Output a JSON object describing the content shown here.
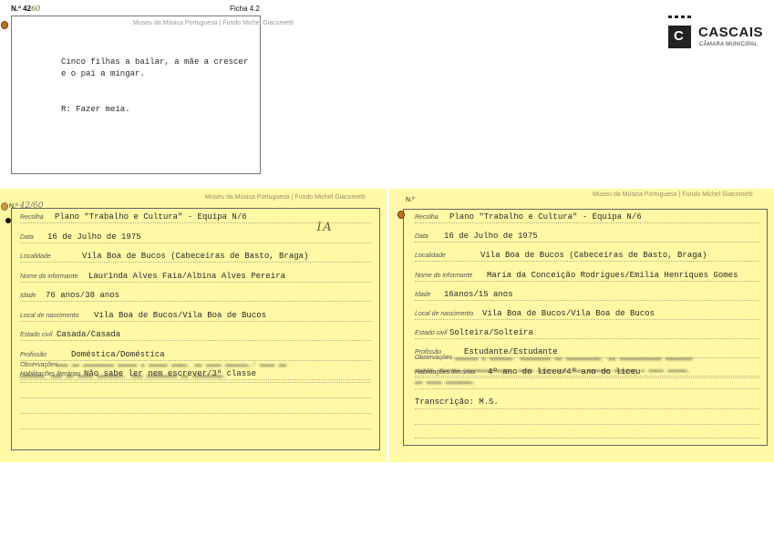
{
  "logo": {
    "name": "CASCAIS",
    "subtitle": "CÂMARA MUNICIPAL",
    "letter": "C"
  },
  "top_card": {
    "number_label": "N.º",
    "number_value": "42",
    "number_handwritten": "60",
    "ficha": "Ficha 4.2",
    "header": "Museu da Música Portuguesa | Fundo Michel Giacometti",
    "line1": "Cinco filhas a bailar, a mãe a crescer",
    "line2": "e o pai a mingar.",
    "answer": "R: Fazer meia."
  },
  "left_card": {
    "number_label": "N.º",
    "number_handwritten": "42/60",
    "header": "Museu da Música Portuguesa | Fundo Michel Giacometti",
    "handwritten_mark": "1A",
    "fields": [
      {
        "label": "Recolha",
        "value": "Plano \"Trabalho e Cultura\" - Equipa N/6"
      },
      {
        "label": "Data",
        "value": "16 de Julho de 1975"
      },
      {
        "label": "Localidade",
        "value": "Vila Boa de Bucos (Cabeceiras de Basto, Braga)"
      },
      {
        "label": "Nome do informante",
        "value": "Laurinda Alves Faia/Albina Alves Pereira"
      },
      {
        "label": "Idade",
        "value": "76 anos/38 anos"
      },
      {
        "label": "Local de nascimento",
        "value": "Vila Boa de Bucos/Vila Boa de Bucos"
      },
      {
        "label": "Estado civil",
        "value": "Casada/Casada"
      },
      {
        "label": "Profissão",
        "value": "Doméstica/Doméstica"
      },
      {
        "label": "Habilitações literárias",
        "value": "Não sabe ler nem escrever/3ª classe"
      }
    ],
    "observacoes_label": "Observações"
  },
  "right_card": {
    "number_label": "N.º",
    "header": "Museu da Música Portuguesa | Fundo Michel Giacometti",
    "fields": [
      {
        "label": "Recolha",
        "value": "Plano \"Trabalho e Cultura\" - Equipa N/6"
      },
      {
        "label": "Data",
        "value": "16 de Julho de 1975"
      },
      {
        "label": "Localidade",
        "value": "Vila Boa de Bucos (Cabeceiras de Basto, Braga)"
      },
      {
        "label": "Nome do informante",
        "value": "Maria da Conceição Rodrigues/Emília Henriques Gomes"
      },
      {
        "label": "Idade",
        "value": "16anos/15 anos"
      },
      {
        "label": "Local de nascimento",
        "value": "Vila Boa de Bucos/Vila Boa de Bucos"
      },
      {
        "label": "Estado civil",
        "value": "Solteira/Solteira"
      },
      {
        "label": "Profissão",
        "value": "Estudante/Estudante"
      },
      {
        "label": "Habilitações literárias",
        "value": "4º ano do liceu/4º ano do liceu"
      }
    ],
    "observacoes_label": "Observações",
    "transcricao": "Transcrição: M.S."
  }
}
